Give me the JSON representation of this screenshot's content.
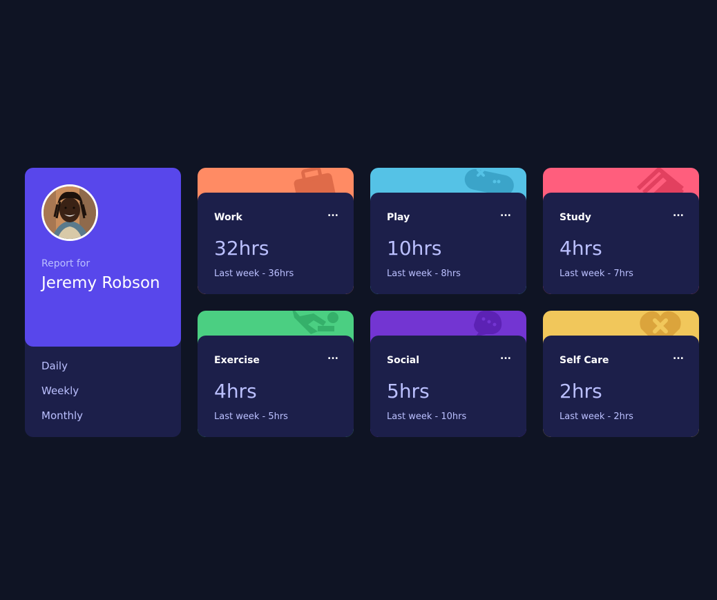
{
  "profile": {
    "report_for": "Report for",
    "name": "Jeremy Robson",
    "accent": "#5847eb"
  },
  "periods": [
    {
      "label": "Daily"
    },
    {
      "label": "Weekly"
    },
    {
      "label": "Monthly"
    }
  ],
  "activities": [
    {
      "title": "Work",
      "menu": "...",
      "current": "32hrs",
      "previous": "Last week - 36hrs",
      "color": "#ff8b64",
      "icon": "briefcase-icon"
    },
    {
      "title": "Play",
      "menu": "...",
      "current": "10hrs",
      "previous": "Last week - 8hrs",
      "color": "#55c2e6",
      "icon": "gamepad-icon"
    },
    {
      "title": "Study",
      "menu": "...",
      "current": "4hrs",
      "previous": "Last week - 7hrs",
      "color": "#ff5e7d",
      "icon": "books-icon"
    },
    {
      "title": "Exercise",
      "menu": "...",
      "current": "4hrs",
      "previous": "Last week - 5hrs",
      "color": "#4bcf82",
      "icon": "runner-icon"
    },
    {
      "title": "Social",
      "menu": "...",
      "current": "5hrs",
      "previous": "Last week - 10hrs",
      "color": "#7335d2",
      "icon": "chat-icon"
    },
    {
      "title": "Self Care",
      "menu": "...",
      "current": "2hrs",
      "previous": "Last week - 2hrs",
      "color": "#f1c75b",
      "icon": "heart-icon"
    }
  ],
  "colors": {
    "background": "#0f1424",
    "card": "#1c1f4a",
    "muted_text": "#bbc0ff"
  }
}
